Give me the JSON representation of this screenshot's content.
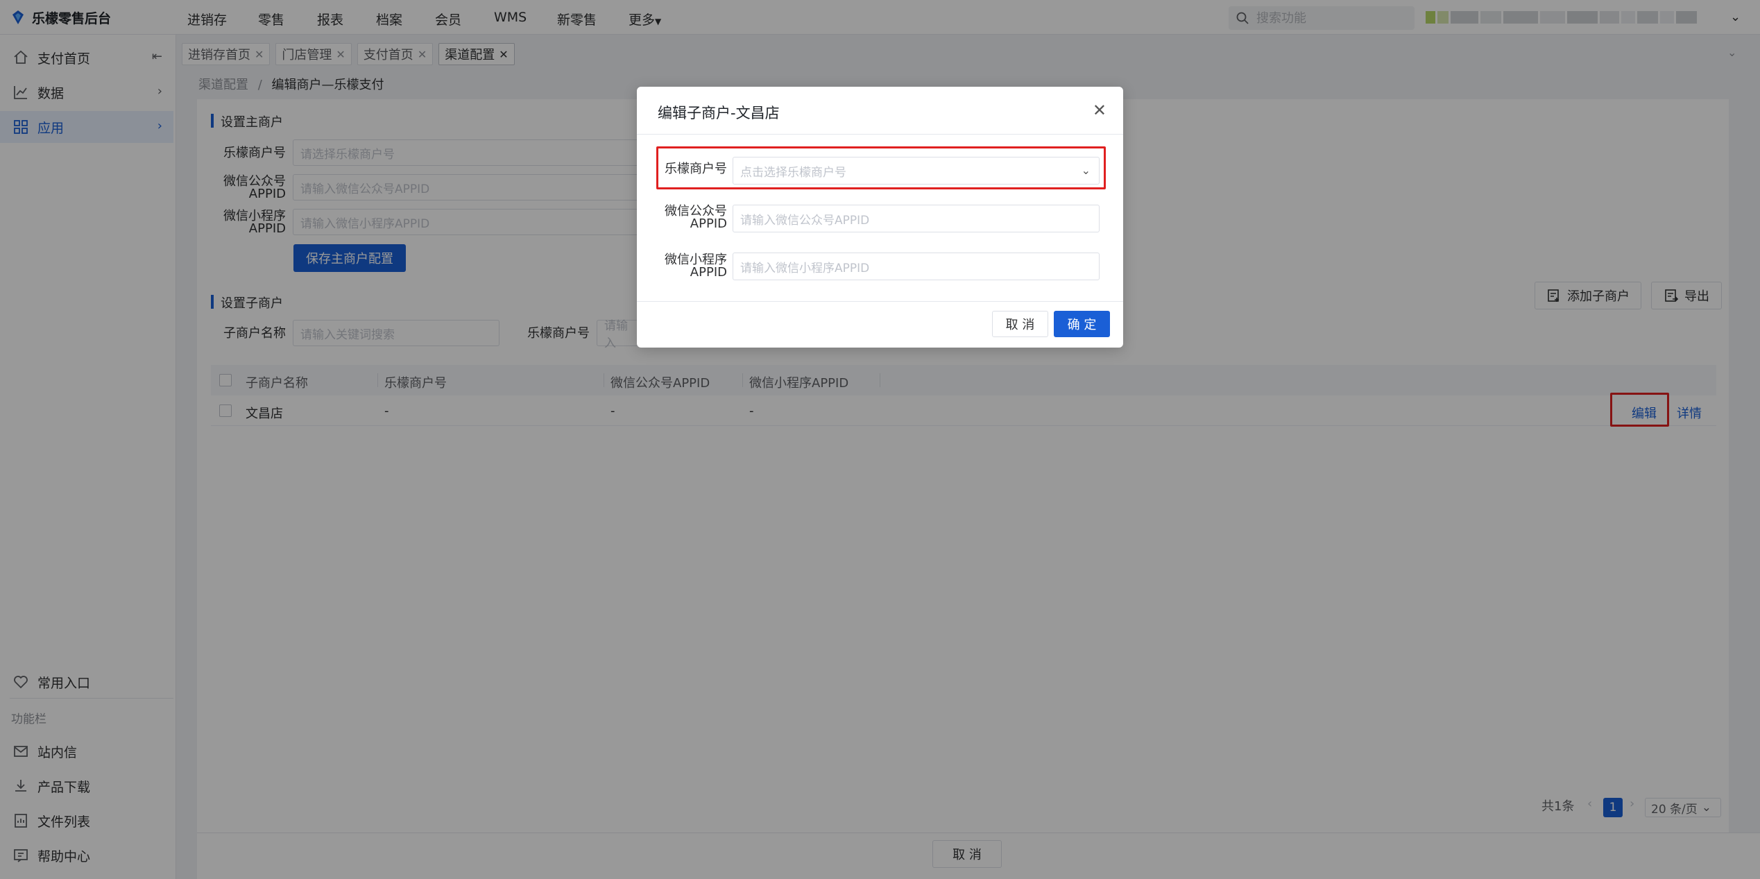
{
  "header": {
    "app_title": "乐檬零售后台",
    "nav": [
      "进销存",
      "零售",
      "报表",
      "档案",
      "会员",
      "WMS",
      "新零售",
      "更多"
    ],
    "search_placeholder": "搜索功能"
  },
  "sidebar": {
    "items": [
      {
        "label": "支付首页",
        "icon": "home-icon"
      },
      {
        "label": "数据",
        "icon": "chart-icon"
      },
      {
        "label": "应用",
        "icon": "apps-icon"
      }
    ],
    "common_entry": "常用入口",
    "section_label": "功能栏",
    "bottom_items": [
      {
        "label": "站内信",
        "icon": "mail-icon"
      },
      {
        "label": "产品下载",
        "icon": "download-icon"
      },
      {
        "label": "文件列表",
        "icon": "file-list-icon"
      },
      {
        "label": "帮助中心",
        "icon": "help-icon"
      }
    ]
  },
  "tabs": [
    {
      "label": "进销存首页"
    },
    {
      "label": "门店管理"
    },
    {
      "label": "支付首页"
    },
    {
      "label": "渠道配置"
    }
  ],
  "breadcrumb": {
    "parent": "渠道配置",
    "separator": "/",
    "current": "编辑商户—乐檬支付"
  },
  "main_merchant": {
    "title": "设置主商户",
    "fields": [
      {
        "label": "乐檬商户号",
        "placeholder": "请选择乐檬商户号"
      },
      {
        "label_line1": "微信公众号",
        "label_line2": "APPID",
        "placeholder": "请输入微信公众号APPID"
      },
      {
        "label_line1": "微信小程序",
        "label_line2": "APPID",
        "placeholder": "请输入微信小程序APPID"
      }
    ],
    "save_button": "保存主商户配置"
  },
  "sub_merchant": {
    "title": "设置子商户",
    "name_label": "子商户名称",
    "name_placeholder": "请输入关键词搜索",
    "merchant_no_label": "乐檬商户号",
    "merchant_no_placeholder": "请输入",
    "add_button": "添加子商户",
    "export_button": "导出"
  },
  "table": {
    "columns": [
      "子商户名称",
      "乐檬商户号",
      "微信公众号APPID",
      "微信小程序APPID"
    ],
    "rows": [
      {
        "name": "文昌店",
        "merchant_no": "-",
        "wx_appid": "-",
        "mini_appid": "-",
        "edit": "编辑",
        "detail": "详情"
      }
    ]
  },
  "pagination": {
    "total": "共1条",
    "current_page": "1",
    "page_size": "20 条/页"
  },
  "footer": {
    "cancel_button": "取 消"
  },
  "modal": {
    "title": "编辑子商户-文昌店",
    "fields": [
      {
        "label": "乐檬商户号",
        "placeholder": "点击选择乐檬商户号"
      },
      {
        "label_line1": "微信公众号",
        "label_line2": "APPID",
        "placeholder": "请输入微信公众号APPID"
      },
      {
        "label_line1": "微信小程序",
        "label_line2": "APPID",
        "placeholder": "请输入微信小程序APPID"
      }
    ],
    "cancel_button": "取 消",
    "confirm_button": "确 定"
  },
  "colors": {
    "primary": "#1a5fd6",
    "highlight": "#e02020",
    "overlay": "rgba(0,0,0,0.4)"
  }
}
